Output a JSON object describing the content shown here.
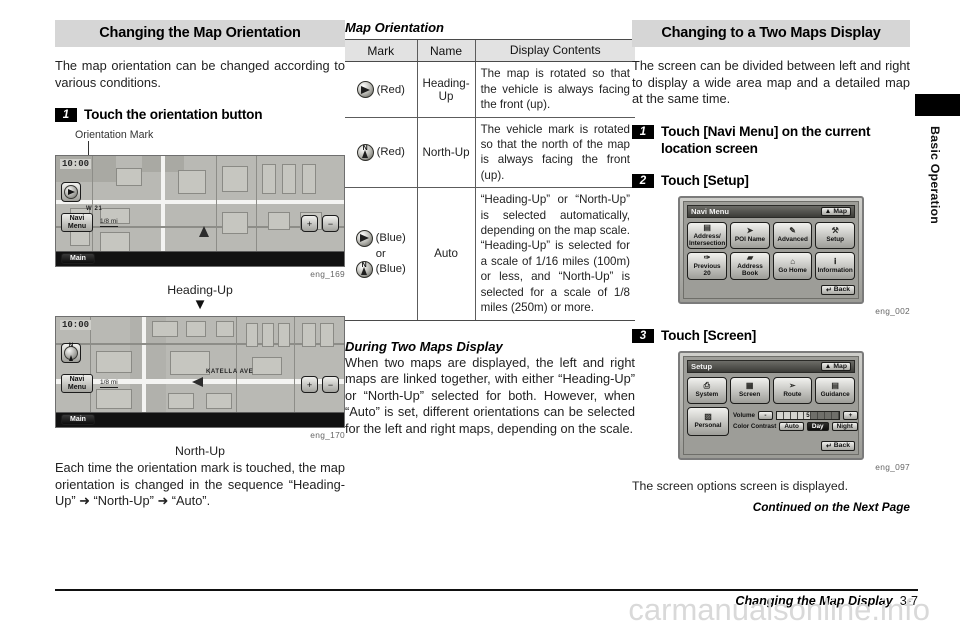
{
  "left": {
    "section_title": "Changing the Map Orientation",
    "intro": "The map orientation can be changed according to various conditions.",
    "step1": {
      "num": "1",
      "text": "Touch the orientation button"
    },
    "callout": "Orientation Mark",
    "fig1": {
      "id": "eng_169",
      "caption": "Heading-Up",
      "clock": "10:00",
      "navi_menu": "Navi Menu",
      "main": "Main",
      "scale": "1/8 mi",
      "zoom_in": "+",
      "zoom_out": "−",
      "street": "W 21"
    },
    "arrow": "▼",
    "fig2": {
      "id": "eng_170",
      "caption": "North-Up",
      "clock": "10:00",
      "navi_menu": "Navi Menu",
      "main": "Main",
      "scale": "1/8 mi",
      "zoom_in": "+",
      "zoom_out": "−",
      "street": "KATELLA AVE"
    },
    "closing": "Each time the orientation mark is touched, the map orientation is changed in the sequence “Heading-Up” ➜ “North-Up” ➜ “Auto”."
  },
  "middle": {
    "table_title": "Map Orientation",
    "headers": [
      "Mark",
      "Name",
      "Display Contents"
    ],
    "rows": [
      {
        "marks": [
          {
            "glyph": "heading",
            "color_label": "(Red)"
          }
        ],
        "name": "Heading-Up",
        "desc": "The map is rotated so that the vehicle is always facing the front (up)."
      },
      {
        "marks": [
          {
            "glyph": "north",
            "color_label": "(Red)"
          }
        ],
        "name": "North-Up",
        "desc": "The vehicle mark is rotated so that the north of the map is always facing the front (up)."
      },
      {
        "marks": [
          {
            "glyph": "heading",
            "color_label": "(Blue)"
          },
          {
            "glyph": "or",
            "color_label": "or"
          },
          {
            "glyph": "north",
            "color_label": "(Blue)"
          }
        ],
        "name": "Auto",
        "desc": "“Heading-Up” or “North-Up” is selected automatically, depending on the map scale. “Heading-Up” is selected for a scale of 1/16 miles (100m) or less, and “North-Up” is selected for a scale of 1/8 miles (250m) or more."
      }
    ],
    "subhead": "During Two Maps Display",
    "body": "When two maps are displayed, the left and right maps are linked together, with either “Heading-Up” or “North-Up” selected for both. However, when “Auto” is set, different orientations can be selected for the left and right maps, depending on the scale."
  },
  "right": {
    "section_title": "Changing to a Two Maps Display",
    "intro": "The screen can be divided between left and right to display a wide area map and a detailed map at the same time.",
    "step1": {
      "num": "1",
      "text": "Touch [Navi Menu] on the current location screen"
    },
    "step2": {
      "num": "2",
      "text": "Touch [Setup]"
    },
    "step3": {
      "num": "3",
      "text": "Touch [Screen]"
    },
    "navi_menu_screen": {
      "id": "eng_002",
      "title": "Navi Menu",
      "map_tab": "Map",
      "back": "Back",
      "buttons": [
        {
          "label": "Address/\nIntersection",
          "icon": "address-icon"
        },
        {
          "label": "POI Name",
          "icon": "poi-icon"
        },
        {
          "label": "Advanced",
          "icon": "advanced-icon"
        },
        {
          "label": "Setup",
          "icon": "setup-icon"
        },
        {
          "label": "Previous\n20",
          "icon": "previous-icon"
        },
        {
          "label": "Address\nBook",
          "icon": "book-icon"
        },
        {
          "label": "Go Home",
          "icon": "home-icon"
        },
        {
          "label": "Information",
          "icon": "info-icon"
        }
      ]
    },
    "setup_screen": {
      "id": "eng_097",
      "title": "Setup",
      "map_tab": "Map",
      "back": "Back",
      "buttons": [
        {
          "label": "System",
          "icon": "system-icon"
        },
        {
          "label": "Screen",
          "icon": "screen-icon"
        },
        {
          "label": "Route",
          "icon": "route-icon"
        },
        {
          "label": "Guidance",
          "icon": "guidance-icon"
        },
        {
          "label": "Personal",
          "icon": "personal-icon"
        }
      ],
      "volume_label": "Volume",
      "volume_minus": "-",
      "volume_plus": "+",
      "volume_value": "5",
      "contrast_label": "Color Contrast",
      "contrast_options": [
        "Auto",
        "Day",
        "Night"
      ],
      "contrast_selected": "Day"
    },
    "note": "The screen options screen is displayed.",
    "continued": "Continued on the Next Page"
  },
  "side_tab": {
    "label": "Basic Operation"
  },
  "footer": {
    "title": "Changing the Map Display",
    "page": "3-7",
    "watermark": "carmanualsonline.info"
  }
}
